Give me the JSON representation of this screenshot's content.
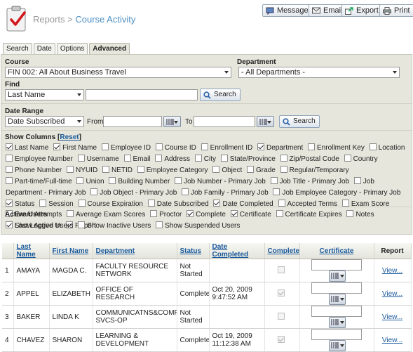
{
  "header": {
    "crumb_parent": "Reports",
    "crumb_sep": ">",
    "crumb_current": "Course Activity",
    "buttons": [
      "Message",
      "Email",
      "Export",
      "Print"
    ]
  },
  "tabs": [
    "Search",
    "Date",
    "Options",
    "Advanced"
  ],
  "active_tab": "Advanced",
  "course": {
    "label": "Course",
    "value": "FIN 002: All About Business Travel"
  },
  "department": {
    "label": "Department",
    "value": "- All Departments -"
  },
  "find": {
    "label": "Find",
    "field": "Last Name",
    "value": "",
    "button": "Search"
  },
  "date_range": {
    "label": "Date Range",
    "field": "Date Subscribed",
    "from_label": "From",
    "to_label": "To",
    "from": "",
    "to": "",
    "button": "Search"
  },
  "show_columns": {
    "label": "Show Columns",
    "reset": "Reset",
    "items": [
      {
        "label": "Last Name",
        "checked": true
      },
      {
        "label": "First Name",
        "checked": true
      },
      {
        "label": "Employee ID",
        "checked": false
      },
      {
        "label": "Course ID",
        "checked": false
      },
      {
        "label": "Enrollment ID",
        "checked": false
      },
      {
        "label": "Department",
        "checked": true
      },
      {
        "label": "Enrollment Key",
        "checked": false
      },
      {
        "label": "Location",
        "checked": false
      },
      {
        "label": "Employee Number",
        "checked": false
      },
      {
        "label": "Username",
        "checked": false
      },
      {
        "label": "Email",
        "checked": false
      },
      {
        "label": "Address",
        "checked": false
      },
      {
        "label": "City",
        "checked": false
      },
      {
        "label": "State/Province",
        "checked": false
      },
      {
        "label": "Zip/Postal Code",
        "checked": false
      },
      {
        "label": "Country",
        "checked": false
      },
      {
        "label": "Phone Number",
        "checked": false
      },
      {
        "label": "NYUID",
        "checked": false
      },
      {
        "label": "NETID",
        "checked": false
      },
      {
        "label": "Employee Category",
        "checked": false
      },
      {
        "label": "Object",
        "checked": false
      },
      {
        "label": "Grade",
        "checked": false
      },
      {
        "label": "Regular/Temporary",
        "checked": false
      },
      {
        "label": "Part-time/Full-time",
        "checked": false
      },
      {
        "label": "Union",
        "checked": false
      },
      {
        "label": "Building Number",
        "checked": false
      },
      {
        "label": "Job Number - Primary Job",
        "checked": false
      },
      {
        "label": "Job Title - Primary Job",
        "checked": false
      },
      {
        "label": "Job Department - Primary Job",
        "checked": false
      },
      {
        "label": "Job Object - Primary Job",
        "checked": false
      },
      {
        "label": "Job Family - Primary Job",
        "checked": false
      },
      {
        "label": "Job Employee Category - Primary Job",
        "checked": false
      },
      {
        "label": "Status",
        "checked": true
      },
      {
        "label": "Session",
        "checked": false
      },
      {
        "label": "Course Expiration",
        "checked": false
      },
      {
        "label": "Date Subscribed",
        "checked": false
      },
      {
        "label": "Date Completed",
        "checked": true
      },
      {
        "label": "Accepted Terms",
        "checked": false
      },
      {
        "label": "Exam Score",
        "checked": false
      },
      {
        "label": "Exam Attempts",
        "checked": false
      },
      {
        "label": "Average Exam Scores",
        "checked": false
      },
      {
        "label": "Proctor",
        "checked": false
      },
      {
        "label": "Complete",
        "checked": true
      },
      {
        "label": "Certificate",
        "checked": true
      },
      {
        "label": "Certificate Expires",
        "checked": false
      },
      {
        "label": "Notes",
        "checked": false
      },
      {
        "label": "Last Logged In",
        "checked": false
      },
      {
        "label": "Report",
        "checked": true
      }
    ]
  },
  "active_users": {
    "label": "Active Users",
    "items": [
      {
        "label": "Show Active Users",
        "checked": true
      },
      {
        "label": "Show Inactive Users",
        "checked": false
      },
      {
        "label": "Show Suspended Users",
        "checked": false
      }
    ]
  },
  "table": {
    "headers": [
      "",
      "Last Name",
      "First Name",
      "Department",
      "Status",
      "Date Completed",
      "Complete",
      "Certificate",
      "Report"
    ],
    "rows": [
      {
        "num": "1",
        "last": "AMAYA",
        "first": "MAGDA C.",
        "dept": "FACULTY RESOURCE NETWORK",
        "status": "Not Started",
        "date": "",
        "time": "",
        "complete": false,
        "report": "View..."
      },
      {
        "num": "2",
        "last": "APPEL",
        "first": "ELIZABETH",
        "dept": "OFFICE OF RESEARCH",
        "status": "Completed",
        "date": "Oct 20, 2009",
        "time": "9:47:52 AM",
        "complete": true,
        "report": "View..."
      },
      {
        "num": "3",
        "last": "BAKER",
        "first": "LINDA K",
        "dept": "COMMUNICATNS&COMPUTING SVCS-OP",
        "status": "Not Started",
        "date": "",
        "time": "",
        "complete": false,
        "report": "View..."
      },
      {
        "num": "4",
        "last": "CHAVEZ",
        "first": "SHARON",
        "dept": "LEARNING & DEVELOPMENT",
        "status": "Completed",
        "date": "Oct 19, 2009",
        "time": "11:12:38 AM",
        "complete": true,
        "report": "View..."
      }
    ]
  }
}
